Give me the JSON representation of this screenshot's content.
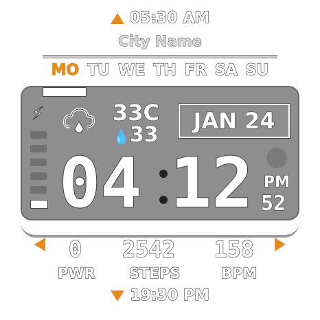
{
  "header": {
    "alarm_time": "05:30 AM",
    "city": "City Name"
  },
  "weekdays": {
    "items": [
      "MO",
      "TU",
      "WE",
      "TH",
      "FR",
      "SA",
      "SU"
    ],
    "active": "MO"
  },
  "lcd": {
    "weather_icon": "cloud-rain-icon",
    "temp_high": "33C",
    "temp_low": "33",
    "date": "JAN 24",
    "hours": "04",
    "minutes": "12",
    "ampm": "PM",
    "seconds": "52",
    "battery_level": 0.2
  },
  "stats": {
    "power": {
      "value": "0",
      "label": "PWR"
    },
    "steps": {
      "value": "2542",
      "label": "STEPS"
    },
    "bpm": {
      "value": "158",
      "label": "BPM"
    }
  },
  "footer": {
    "alt_time": "19:30 PM"
  },
  "colors": {
    "accent": "#e58a1f",
    "lcd_bg": "#8e8e8e"
  }
}
